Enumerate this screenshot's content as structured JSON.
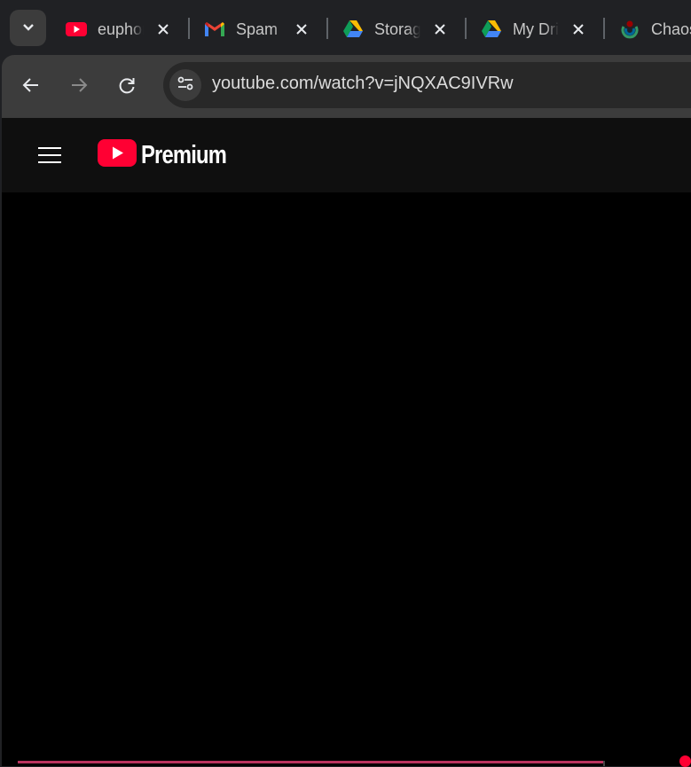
{
  "tabs": [
    {
      "title": "euphoria",
      "favicon": "youtube-icon"
    },
    {
      "title": "Spam",
      "favicon": "gmail-icon"
    },
    {
      "title": "Storage",
      "favicon": "google-drive-icon"
    },
    {
      "title": "My Drive",
      "favicon": "google-drive-icon"
    },
    {
      "title": "Chaos",
      "favicon": "wikimedia-icon"
    }
  ],
  "omnibox": {
    "url": "youtube.com/watch?v=jNQXAC9IVRw"
  },
  "youtube": {
    "logo_text": "Premium"
  },
  "colors": {
    "youtube_red": "#ff0033",
    "progress": "#b9345e"
  }
}
